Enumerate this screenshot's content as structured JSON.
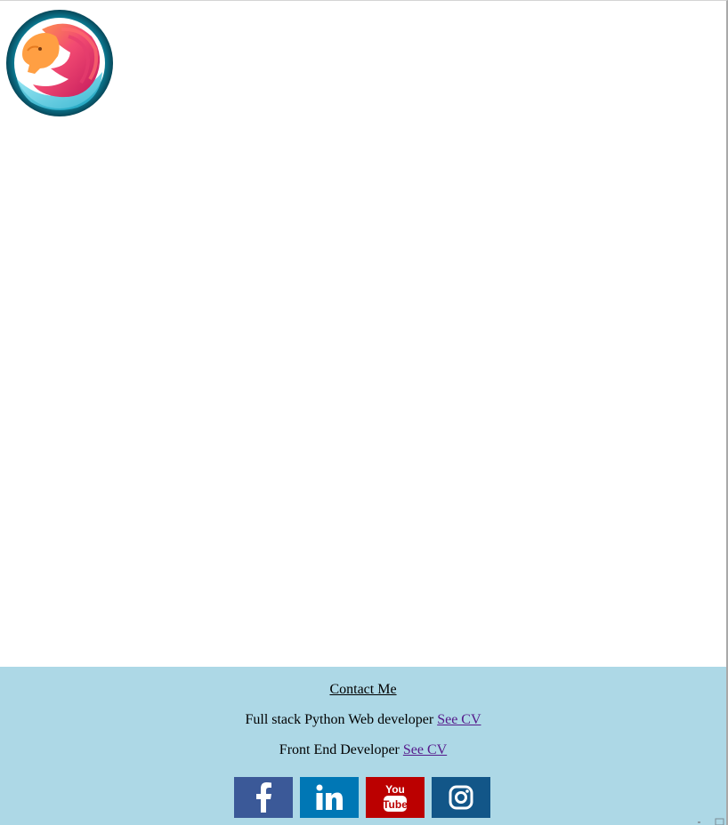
{
  "header": {
    "logo_icon": "lion-mascot-logo-icon"
  },
  "footer": {
    "contact_label": "Contact Me",
    "roles": [
      {
        "title": "Full stack Python Web developer",
        "link_label": "See CV"
      },
      {
        "title": "Front End Developer",
        "link_label": "See CV"
      }
    ],
    "social": [
      {
        "icon": "facebook-icon",
        "color": "#3b5998"
      },
      {
        "icon": "linkedin-icon",
        "color": "#0077b5"
      },
      {
        "icon": "youtube-icon",
        "color": "#bb0000"
      },
      {
        "icon": "instagram-icon",
        "color": "#125688"
      }
    ],
    "background_color": "#add8e6"
  }
}
